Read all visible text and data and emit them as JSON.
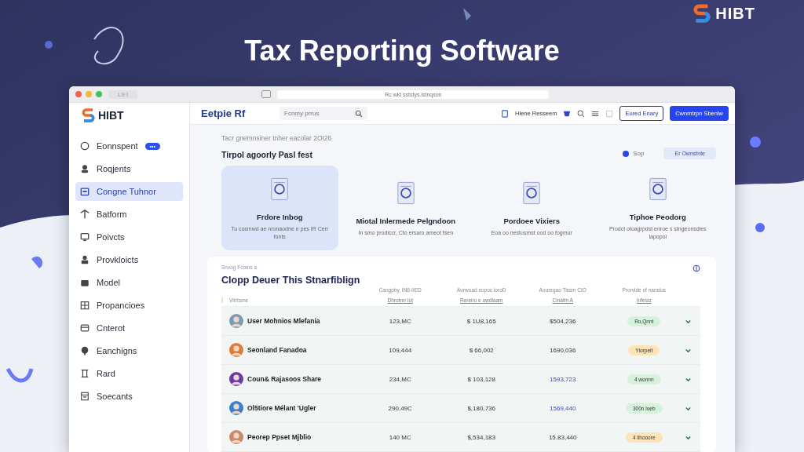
{
  "banner": {
    "title": "Tax Reporting Software",
    "logo": "HIBT"
  },
  "browser": {
    "tab_text": "L9 I",
    "address": "Rc wkt sststys.lstnqson"
  },
  "sidebar": {
    "logo": "HIBT",
    "items": [
      {
        "label": "Eonnspent",
        "selected": false,
        "badge": "•••"
      },
      {
        "label": "Roqjents",
        "selected": false
      },
      {
        "label": "Congne Tuhnor",
        "selected": true
      },
      {
        "label": "Batform",
        "selected": false
      },
      {
        "label": "Poivcts",
        "selected": false
      },
      {
        "label": "Provkloicts",
        "selected": false
      },
      {
        "label": "Model",
        "selected": false
      },
      {
        "label": "Propancioes",
        "selected": false
      },
      {
        "label": "Cnterot",
        "selected": false
      },
      {
        "label": "Eanchigns",
        "selected": false
      },
      {
        "label": "Rard",
        "selected": false
      },
      {
        "label": "Soecants",
        "selected": false
      }
    ]
  },
  "header": {
    "title": "Eetpie Rf",
    "search": {
      "placeholder": "Fcnmy prrus"
    },
    "account": "Hlene Resseem",
    "buttons": [
      {
        "label": "Eured Enary",
        "kind": "outline"
      },
      {
        "label": "Cwnmtrpn Sbenlw",
        "kind": "primary"
      }
    ]
  },
  "intro": {
    "subtitle": "Tacr gnemnsiner tnher eacolar 2OI26",
    "heading": "Tirpol agoorly Pasl fest",
    "toggle_label": "Sop",
    "toggle": {
      "on": true
    },
    "action": "Er Ownstnte"
  },
  "cards": [
    {
      "title": "Frdore Inbog",
      "text": "Tu cosmwd ae nronaodne e pes IR Cerr fonts",
      "selected": true
    },
    {
      "title": "Miotal Inlermede Pelgndoon",
      "text": "In smo prodiccr, Cto ersaro ameot fsen",
      "selected": false
    },
    {
      "title": "Pordoee Vixiers",
      "text": "Eoa oo nestusmst ood oo fogmur",
      "selected": false
    },
    {
      "title": "Tiphoe Peodorg",
      "text": "Prodct otoagrpdst enroe s stngeonsdies lapopoi",
      "selected": false
    }
  ],
  "table": {
    "eyebrow": "Snvog Fcoms a",
    "title": "Clopp Deuer This Stnarfiblign",
    "columns": [
      {
        "label": "Vlrrtsme"
      },
      {
        "label": "Cangphy, IN6-IIED",
        "sub": "Dhrotrer lut"
      },
      {
        "label": "Aurwoad eopoc ioroD",
        "sub": "Rereiro e owdlaam"
      },
      {
        "label": "Aouregao Tissm CIO",
        "sub": "Cinafm A"
      },
      {
        "label": "Prorvide of nansius",
        "sub": "Infesiz"
      }
    ],
    "rows": [
      {
        "name": "User Mohnios Mlefania",
        "c1": "123,MC",
        "c2": "$ 1U8,165",
        "c3": "$504,236",
        "c3_accent": false,
        "status": "Ro,Qnnt",
        "color": "#d7f2dc"
      },
      {
        "name": "Seonland Fanadoa",
        "c1": "109,444",
        "c2": "$ 66,002",
        "c3": "1690,036",
        "c3_accent": false,
        "status": "Ylorpeit",
        "color": "#fde3b8"
      },
      {
        "name": "Coun& Rajasoos Share",
        "c1": "234,MC",
        "c2": "$ 103,128",
        "c3": "1593,723",
        "c3_accent": true,
        "status": "4 wonnn",
        "color": "#d7f2dc"
      },
      {
        "name": "Ol5tiore Mélant 'Ugler",
        "c1": "290,49C",
        "c2": "$,180,736",
        "c3": "1569,440",
        "c3_accent": true,
        "status": "300n loeb",
        "color": "#d7f2dc"
      },
      {
        "name": "Peorep Ppset Mjblio",
        "c1": "140 MC",
        "c2": "$,534,183",
        "c3": "15.83,440",
        "c3_accent": false,
        "status": "4 lihooore",
        "color": "#fde3b8"
      }
    ]
  }
}
